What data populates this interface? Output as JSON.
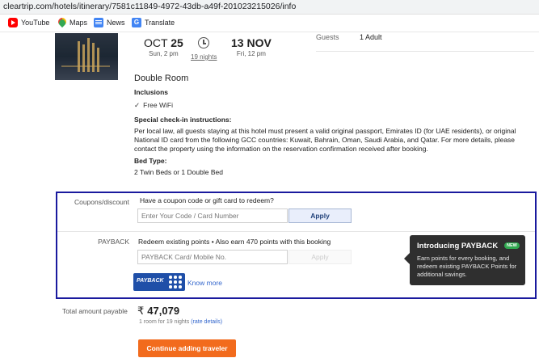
{
  "browser": {
    "url": "cleartrip.com/hotels/itinerary/7581c11849-4972-43db-a49f-201023215026/info",
    "bookmarks": [
      {
        "label": "YouTube",
        "icon": "youtube-icon"
      },
      {
        "label": "Maps",
        "icon": "maps-icon"
      },
      {
        "label": "News",
        "icon": "news-icon"
      },
      {
        "label": "Translate",
        "icon": "translate-icon"
      }
    ]
  },
  "booking": {
    "checkin": {
      "month": "OCT",
      "day": "25",
      "sub": "Sun, 2 pm"
    },
    "nights": "19 nights",
    "checkout": {
      "day": "13",
      "month": "NOV",
      "sub": "Fri, 12 pm"
    },
    "guests_label": "Guests",
    "guests_value": "1 Adult",
    "room_title": "Double Room",
    "inclusions_title": "Inclusions",
    "inclusions": [
      "Free WiFi"
    ],
    "special_title": "Special check-in instructions:",
    "special_text": "Per local law, all guests staying at this hotel must present a valid original passport, Emirates ID (for UAE residents), or original National ID card from the following GCC countries: Kuwait, Bahrain, Oman, Saudi Arabia, and Qatar. For more details, please contact the property using the information on the reservation confirmation received after booking.",
    "bed_title": "Bed Type:",
    "bed_text": "2 Twin Beds or 1 Double Bed"
  },
  "coupon": {
    "label": "Coupons/discount",
    "heading": "Have a coupon code or gift card to redeem?",
    "placeholder": "Enter Your Code / Card Number",
    "apply": "Apply"
  },
  "payback": {
    "label": "PAYBACK",
    "heading": "Redeem existing points • Also earn 470 points with this booking",
    "placeholder": "PAYBACK Card/ Mobile No.",
    "apply": "Apply",
    "logo_text": "PAYBACK",
    "know_more": "Know more"
  },
  "tooltip": {
    "title": "Introducing PAYBACK",
    "badge": "NEW",
    "body": "Earn points for every booking, and redeem existing PAYBACK Points for additional savings."
  },
  "total": {
    "label": "Total amount payable",
    "currency": "₹",
    "amount": "47,079",
    "sub": "1 room for 19 nights",
    "rate_details": "(rate details)"
  },
  "cta": {
    "label": "Continue adding traveler"
  },
  "colors": {
    "accent_orange": "#f26b1d",
    "outline_blue": "#1a1a9e",
    "link_blue": "#3366cc",
    "payback_blue": "#1f4fa8",
    "badge_green": "#2fa84f"
  }
}
